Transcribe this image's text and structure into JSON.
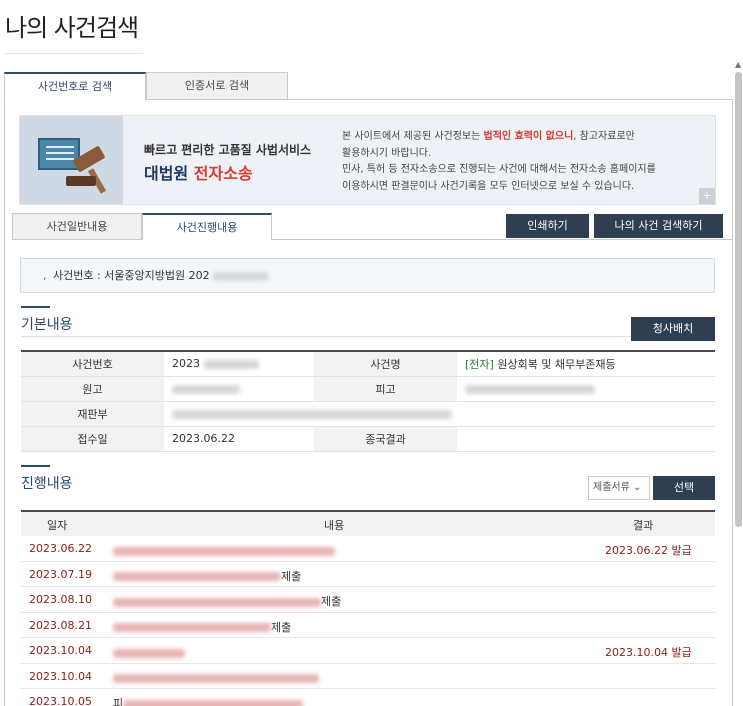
{
  "page_title": "나의 사건검색",
  "top_tabs": [
    {
      "label": "사건번호로 검색",
      "active": true
    },
    {
      "label": "인증서로 검색",
      "active": false
    }
  ],
  "banner": {
    "subtitle": "빠르고 편리한 고품질 사법서비스",
    "main_blue": "대법원",
    "main_red": "전자소송",
    "text_line1_pre": "본 사이트에서 제공된 사건정보는 ",
    "text_line1_warn": "법적인 효력이 없으니",
    "text_line1_post": ", 참고자료로만",
    "text_line2": "활용하시기 바랍니다.",
    "text_line3": "민사, 특허 등 전자소송으로 진행되는 사건에 대해서는 전자소송 홈페이지를",
    "text_line4": "이용하시면 판결문이나 사건기록을 모두 인터넷으로 보실 수 있습니다.",
    "more": "+"
  },
  "sub_tabs": [
    {
      "label": "사건일반내용",
      "active": false
    },
    {
      "label": "사건진행내용",
      "active": true
    }
  ],
  "buttons": {
    "print": "인쇄하기",
    "my_search": "나의 사건 검색하기",
    "jeongsa": "청사배치",
    "select": "선택"
  },
  "case_number": {
    "prefix": "사건번호 : 서울중앙지방법원 202"
  },
  "basic_section": {
    "title": "기본내용",
    "rows": [
      {
        "label1": "사건번호",
        "value1": "2023",
        "label2": "사건명",
        "value2_tag": "[전자]",
        "value2": "원상회복 및 채무부존재등"
      },
      {
        "label1": "원고",
        "value1": "",
        "label2": "피고",
        "value2_tag": "",
        "value2": ""
      },
      {
        "label1": "재판부",
        "value1": "",
        "label2": "",
        "value2_tag": "",
        "value2": ""
      },
      {
        "label1": "접수일",
        "value1": "2023.06.22",
        "label2": "종국결과",
        "value2_tag": "",
        "value2": ""
      }
    ]
  },
  "progress_section": {
    "title": "진행내용",
    "filter_label": "제출서류",
    "filter_icon": "chevron-down-icon",
    "headers": [
      "일자",
      "내용",
      "결과"
    ],
    "rows": [
      {
        "date": "2023.06.22",
        "content_visible": "",
        "result": "2023.06.22 발급"
      },
      {
        "date": "2023.07.19",
        "content_visible": "제출",
        "result": ""
      },
      {
        "date": "2023.08.10",
        "content_visible": "제출",
        "result": ""
      },
      {
        "date": "2023.08.21",
        "content_visible": "제출",
        "result": ""
      },
      {
        "date": "2023.10.04",
        "content_visible": "",
        "result": "2023.10.04 발급"
      },
      {
        "date": "2023.10.04",
        "content_visible": "",
        "result": ""
      },
      {
        "date": "2023.10.05",
        "content_visible": "피",
        "result": ""
      }
    ]
  }
}
